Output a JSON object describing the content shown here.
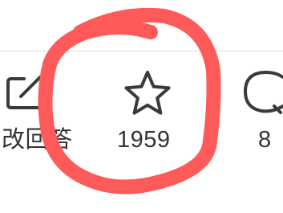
{
  "action_bar": {
    "items": [
      {
        "icon": "edit-icon",
        "label": "改回答"
      },
      {
        "icon": "star-icon",
        "label": "1959"
      },
      {
        "icon": "comment-icon",
        "label": "8"
      }
    ]
  },
  "annotation": {
    "color": "#ff5a5a"
  }
}
